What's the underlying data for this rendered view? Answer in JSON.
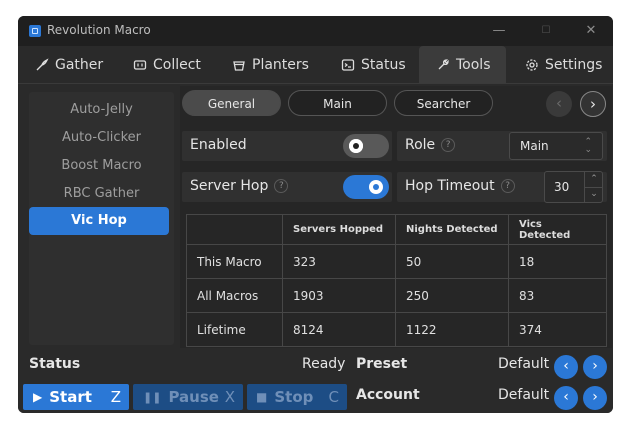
{
  "window": {
    "title": "Revolution Macro",
    "controls": [
      "—",
      "☐",
      "✕"
    ]
  },
  "tabs": [
    {
      "label": "Gather",
      "icon": "gather-icon"
    },
    {
      "label": "Collect",
      "icon": "collect-icon"
    },
    {
      "label": "Planters",
      "icon": "planters-icon"
    },
    {
      "label": "Status",
      "icon": "status-icon"
    },
    {
      "label": "Tools",
      "icon": "tools-icon",
      "active": true
    },
    {
      "label": "Settings",
      "icon": "settings-icon"
    }
  ],
  "sidebar": {
    "items": [
      "Auto-Jelly",
      "Auto-Clicker",
      "Boost Macro",
      "RBC Gather",
      "Vic Hop"
    ],
    "active_index": 4
  },
  "subtabs": {
    "items": [
      "General",
      "Main",
      "Searcher"
    ],
    "active_index": 0,
    "prev": "‹",
    "next": "›"
  },
  "settings": {
    "enabled_label": "Enabled",
    "enabled_value": false,
    "role_label": "Role",
    "role_value": "Main",
    "help_glyph": "?",
    "server_hop_label": "Server Hop",
    "server_hop_value": true,
    "hop_timeout_label": "Hop Timeout",
    "hop_timeout_value": "30"
  },
  "stats": {
    "headers": [
      "",
      "Servers Hopped",
      "Nights Detected",
      "Vics Detected"
    ],
    "rows": [
      [
        "This Macro",
        "323",
        "50",
        "18"
      ],
      [
        "All Macros",
        "1903",
        "250",
        "83"
      ],
      [
        "Lifetime",
        "8124",
        "1122",
        "374"
      ]
    ]
  },
  "footer": {
    "status_label": "Status",
    "status_value": "Ready",
    "preset_label": "Preset",
    "preset_value": "Default",
    "account_label": "Account",
    "account_value": "Default",
    "start": {
      "label": "Start",
      "key": "Z"
    },
    "pause": {
      "label": "Pause",
      "key": "X"
    },
    "stop": {
      "label": "Stop",
      "key": "C"
    }
  },
  "colors": {
    "accent": "#2b78d6",
    "background": "#2a2a2a",
    "panel": "#262626"
  }
}
